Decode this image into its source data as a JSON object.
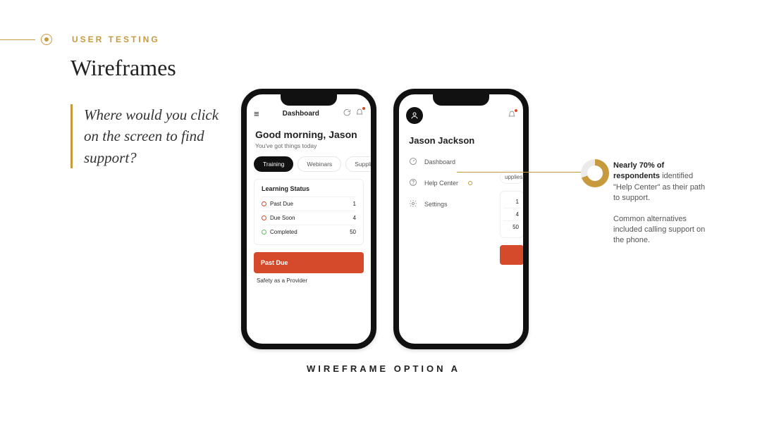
{
  "section_label": "USER TESTING",
  "page_title": "Wireframes",
  "question": "Where would you click on the screen to find support?",
  "caption": "WIREFRAME OPTION A",
  "annotation": {
    "headline": "Nearly 70% of respondents",
    "line1": "identified \"Help Center\" as their path to support.",
    "line2": "Common alternatives included calling support on the phone.",
    "percent": 70
  },
  "phone1": {
    "header_title": "Dashboard",
    "greeting": "Good morning, Jason",
    "subtext": "You've got things today",
    "tabs": [
      "Training",
      "Webinars",
      "Supplies"
    ],
    "card_title": "Learning Status",
    "rows": [
      {
        "label": "Past Due",
        "value": "1"
      },
      {
        "label": "Due Soon",
        "value": "4"
      },
      {
        "label": "Completed",
        "value": "50"
      }
    ],
    "past_due_label": "Past Due",
    "mini_text": "Safety as a Provider"
  },
  "phone2": {
    "user_name": "Jason Jackson",
    "menu": [
      {
        "label": "Dashboard"
      },
      {
        "label": "Help Center"
      },
      {
        "label": "Settings"
      }
    ],
    "peek_tab": "upplies",
    "peek_values": [
      "1",
      "4",
      "50"
    ]
  }
}
